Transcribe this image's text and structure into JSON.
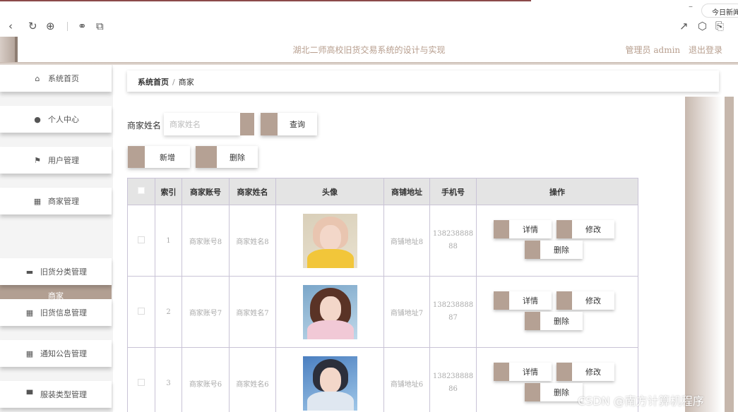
{
  "browser": {
    "tab_label": "今日新闻",
    "minimize": "–"
  },
  "header": {
    "title": "湖北二师高校旧货交易系统的设计与实现",
    "user_label": "管理员 admin",
    "logout_label": "退出登录"
  },
  "sidebar": {
    "items": [
      {
        "label": "系统首页",
        "icon": "home-icon"
      },
      {
        "label": "个人中心",
        "icon": "user-icon"
      },
      {
        "label": "用户管理",
        "icon": "flag-icon"
      },
      {
        "label": "商家管理",
        "icon": "grid-icon"
      },
      {
        "label": "旧货分类管理",
        "icon": "chat-icon"
      },
      {
        "label": "旧货信息管理",
        "icon": "grid-icon"
      },
      {
        "label": "通知公告管理",
        "icon": "grid-icon"
      },
      {
        "label": "服装类型管理",
        "icon": "monitor-icon"
      }
    ],
    "active_sub": "商家"
  },
  "breadcrumb": {
    "home": "系统首页",
    "separator": "/",
    "current": "商家"
  },
  "search": {
    "label": "商家姓名",
    "placeholder": "商家姓名",
    "button": "查询"
  },
  "actions": {
    "add": "新增",
    "delete": "删除"
  },
  "table": {
    "columns": [
      "索引",
      "商家账号",
      "商家姓名",
      "头像",
      "商铺地址",
      "手机号",
      "操作"
    ],
    "rows": [
      {
        "index": "1",
        "account": "商家账号8",
        "name": "商家姓名8",
        "address": "商铺地址8",
        "phone_a": "138238888",
        "phone_b": "88"
      },
      {
        "index": "2",
        "account": "商家账号7",
        "name": "商家姓名7",
        "address": "商铺地址7",
        "phone_a": "138238888",
        "phone_b": "87"
      },
      {
        "index": "3",
        "account": "商家账号6",
        "name": "商家姓名6",
        "address": "商铺地址6",
        "phone_a": "138238888",
        "phone_b": "86"
      }
    ],
    "op_labels": {
      "detail": "详情",
      "edit": "修改",
      "delete": "删除"
    }
  },
  "watermark": "CSDN @南方计算机程序",
  "colors": {
    "accent": "#b5a194",
    "active_menu": "#b29f92",
    "header_text": "#b79e8e"
  }
}
